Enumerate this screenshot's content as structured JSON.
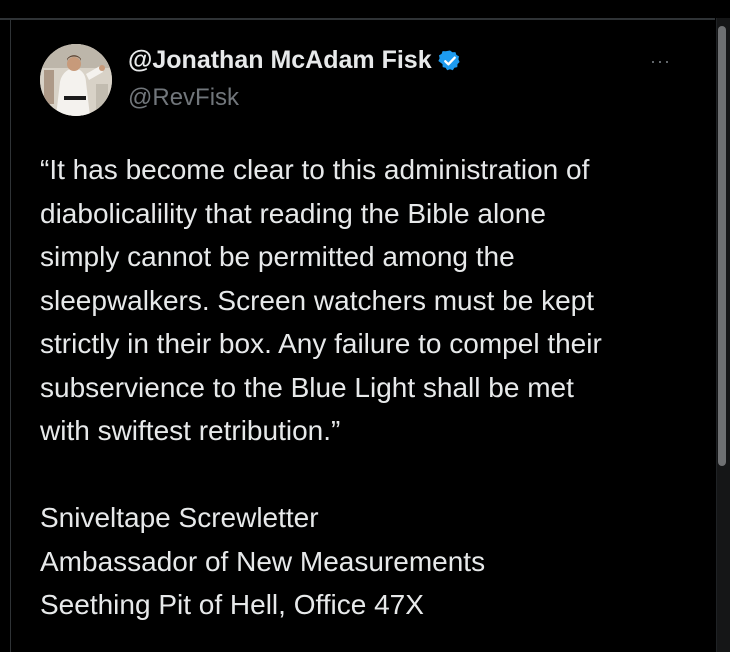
{
  "tweet": {
    "display_name": "@Jonathan McAdam Fisk",
    "handle": "@RevFisk",
    "verified_icon": "verified-badge-icon",
    "verified_color": "#1d9bf0",
    "more_label": "···",
    "quote_lines": [
      "“It has become clear to this administration of",
      "diabolicalility that reading the Bible alone",
      "simply cannot be permitted among the",
      "sleepwalkers. Screen watchers must be kept",
      "strictly in their box. Any failure to compel their",
      "subservience to the Blue Light shall be met",
      "with swiftest retribution.”"
    ],
    "signature_lines": [
      "Sniveltape Screwletter",
      "Ambassador of New Measurements",
      "Seething Pit of Hell, Office 47X"
    ]
  },
  "colors": {
    "background": "#000000",
    "text": "#e7e9ea",
    "muted": "#71767b",
    "accent": "#1d9bf0"
  }
}
